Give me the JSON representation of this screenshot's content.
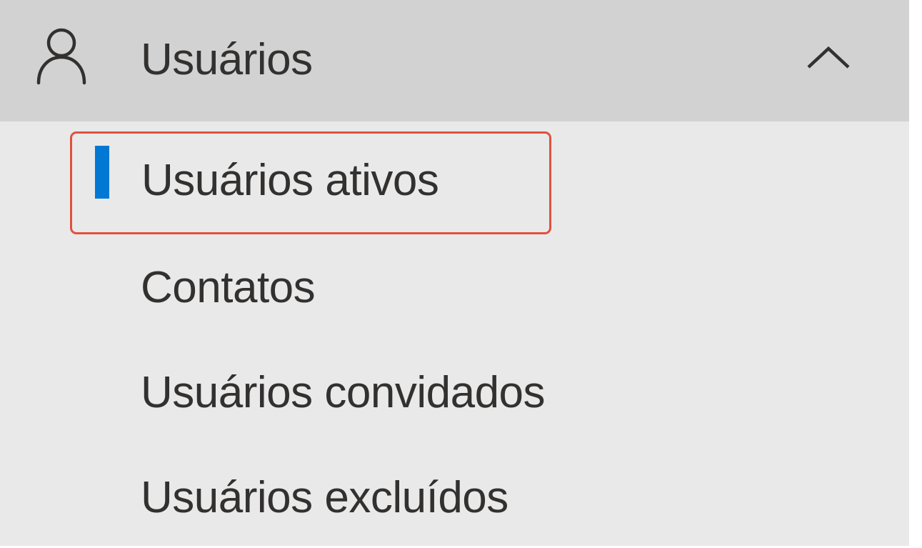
{
  "nav": {
    "group": {
      "label": "Usuários",
      "icon": "user-icon",
      "expanded": true,
      "toggle_icon": "chevron-up-icon"
    },
    "items": [
      {
        "label": "Usuários ativos",
        "selected": true
      },
      {
        "label": "Contatos",
        "selected": false
      },
      {
        "label": "Usuários convidados",
        "selected": false
      },
      {
        "label": "Usuários excluídos",
        "selected": false
      }
    ]
  },
  "colors": {
    "header_background": "#d2d2d2",
    "panel_background": "#e9e9e9",
    "text": "#323130",
    "selection_indicator": "#0078d4",
    "highlight_border": "#e0513e"
  }
}
